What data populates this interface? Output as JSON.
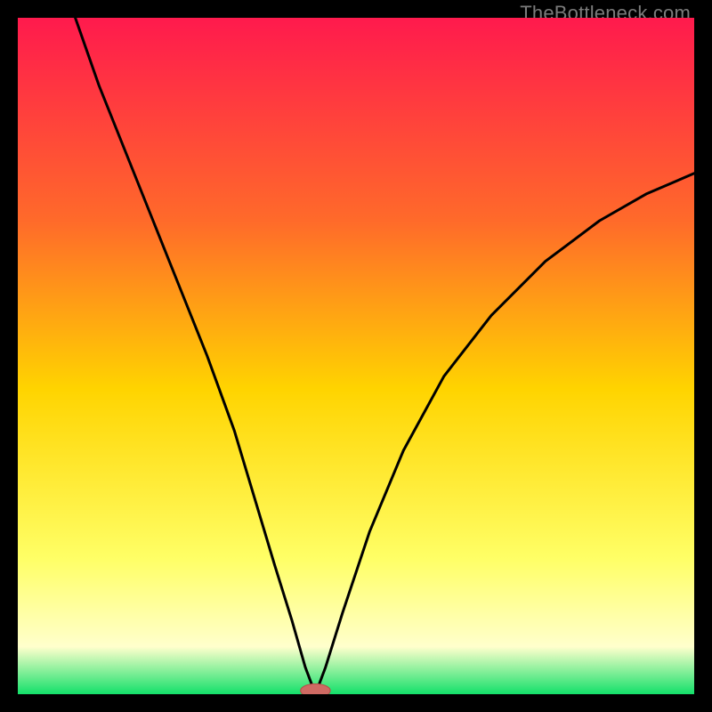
{
  "watermark": "TheBottleneck.com",
  "colors": {
    "frame": "#000000",
    "grad_top": "#ff1a4d",
    "grad_upper": "#ff6a2a",
    "grad_mid": "#ffd400",
    "grad_lower": "#ffff66",
    "grad_pale": "#ffffcc",
    "grad_green": "#13e06a",
    "curve": "#000000",
    "marker_fill": "#cf6a63",
    "marker_stroke": "#b54f48"
  },
  "chart_data": {
    "type": "line",
    "title": "",
    "xlabel": "",
    "ylabel": "",
    "xlim": [
      0,
      100
    ],
    "ylim": [
      0,
      100
    ],
    "optimum_x": 44,
    "marker": {
      "x": 44,
      "y": 0,
      "rx": 2.2,
      "ry": 1.0
    },
    "curve_points": [
      {
        "x": 8.5,
        "y": 100
      },
      {
        "x": 12,
        "y": 90
      },
      {
        "x": 16,
        "y": 80
      },
      {
        "x": 20,
        "y": 70
      },
      {
        "x": 24,
        "y": 60
      },
      {
        "x": 28,
        "y": 50
      },
      {
        "x": 32,
        "y": 39
      },
      {
        "x": 35,
        "y": 29
      },
      {
        "x": 38,
        "y": 19
      },
      {
        "x": 40.5,
        "y": 11
      },
      {
        "x": 42.5,
        "y": 4
      },
      {
        "x": 44,
        "y": 0
      },
      {
        "x": 45.5,
        "y": 4
      },
      {
        "x": 48,
        "y": 12
      },
      {
        "x": 52,
        "y": 24
      },
      {
        "x": 57,
        "y": 36
      },
      {
        "x": 63,
        "y": 47
      },
      {
        "x": 70,
        "y": 56
      },
      {
        "x": 78,
        "y": 64
      },
      {
        "x": 86,
        "y": 70
      },
      {
        "x": 93,
        "y": 74
      },
      {
        "x": 100,
        "y": 77
      }
    ],
    "gradient_stops": [
      {
        "offset": 0.0,
        "key": "grad_top"
      },
      {
        "offset": 0.3,
        "key": "grad_upper"
      },
      {
        "offset": 0.55,
        "key": "grad_mid"
      },
      {
        "offset": 0.8,
        "key": "grad_lower"
      },
      {
        "offset": 0.93,
        "key": "grad_pale"
      },
      {
        "offset": 1.0,
        "key": "grad_green"
      }
    ]
  }
}
